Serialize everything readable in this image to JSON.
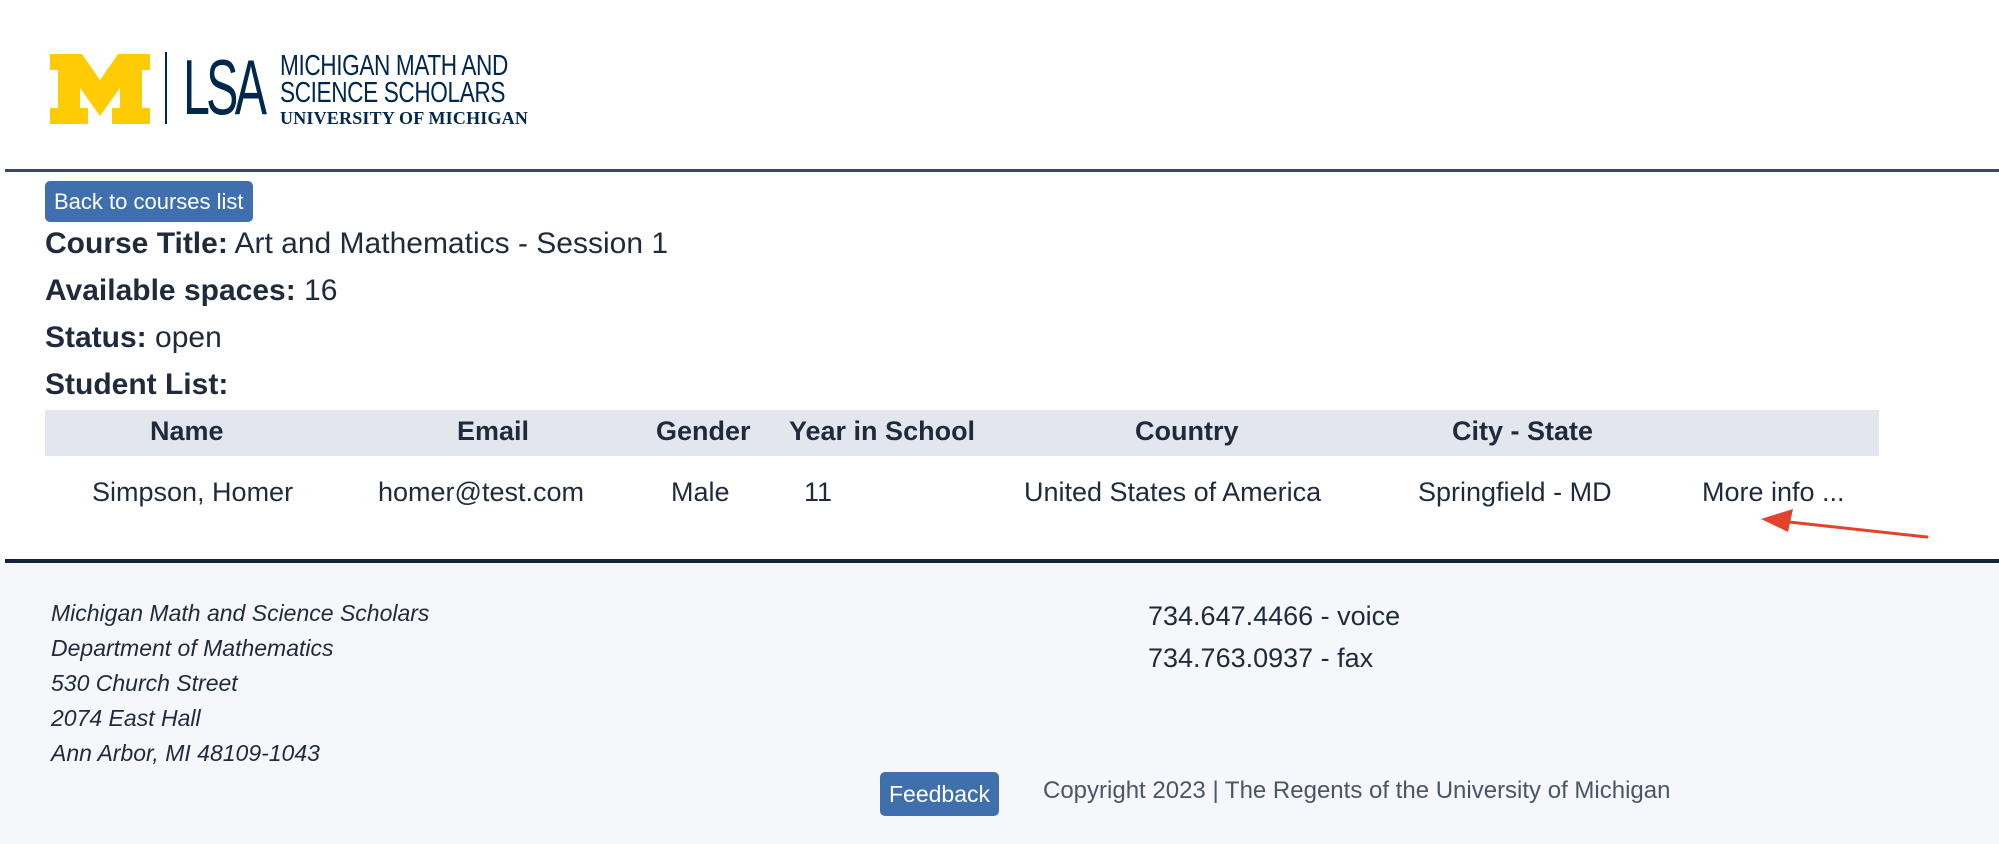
{
  "header": {
    "logo": {
      "lsa_text": "LSA",
      "line1": "MICHIGAN MATH AND",
      "line2": "SCIENCE SCHOLARS",
      "line3": "UNIVERSITY OF MICHIGAN",
      "maize": "#ffcb05",
      "blue": "#00274c"
    }
  },
  "main": {
    "back_button": "Back to courses list",
    "course_title_label": "Course Title:",
    "course_title_value": "Art and Mathematics - Session 1",
    "available_spaces_label": "Available spaces:",
    "available_spaces_value": "16",
    "status_label": "Status:",
    "status_value": "open",
    "student_list_label": "Student List:",
    "table": {
      "columns": [
        "Name",
        "Email",
        "Gender",
        "Year in School",
        "Country",
        "City - State"
      ],
      "rows": [
        {
          "name": "Simpson, Homer",
          "email": "homer@test.com",
          "gender": "Male",
          "year": "11",
          "country": "United States of America",
          "city_state": "Springfield - MD",
          "more": "More info ..."
        }
      ]
    },
    "annotation": {
      "arrow_color": "#e0442a",
      "icon": "arrow-icon"
    }
  },
  "footer": {
    "address": [
      "Michigan Math and Science Scholars",
      "Department of Mathematics",
      "530 Church Street",
      "2074 East Hall",
      "Ann Arbor, MI 48109-1043"
    ],
    "phone_voice": "734.647.4466 - voice",
    "phone_fax": "734.763.0937 - fax",
    "feedback_button": "Feedback",
    "copyright": "Copyright 2023 | The Regents of the University of Michigan"
  },
  "colors": {
    "button_bg": "#3f6fad",
    "table_header_bg": "#e3e7ed",
    "footer_bg": "#f5f7fa",
    "text": "#1f2a3c"
  }
}
